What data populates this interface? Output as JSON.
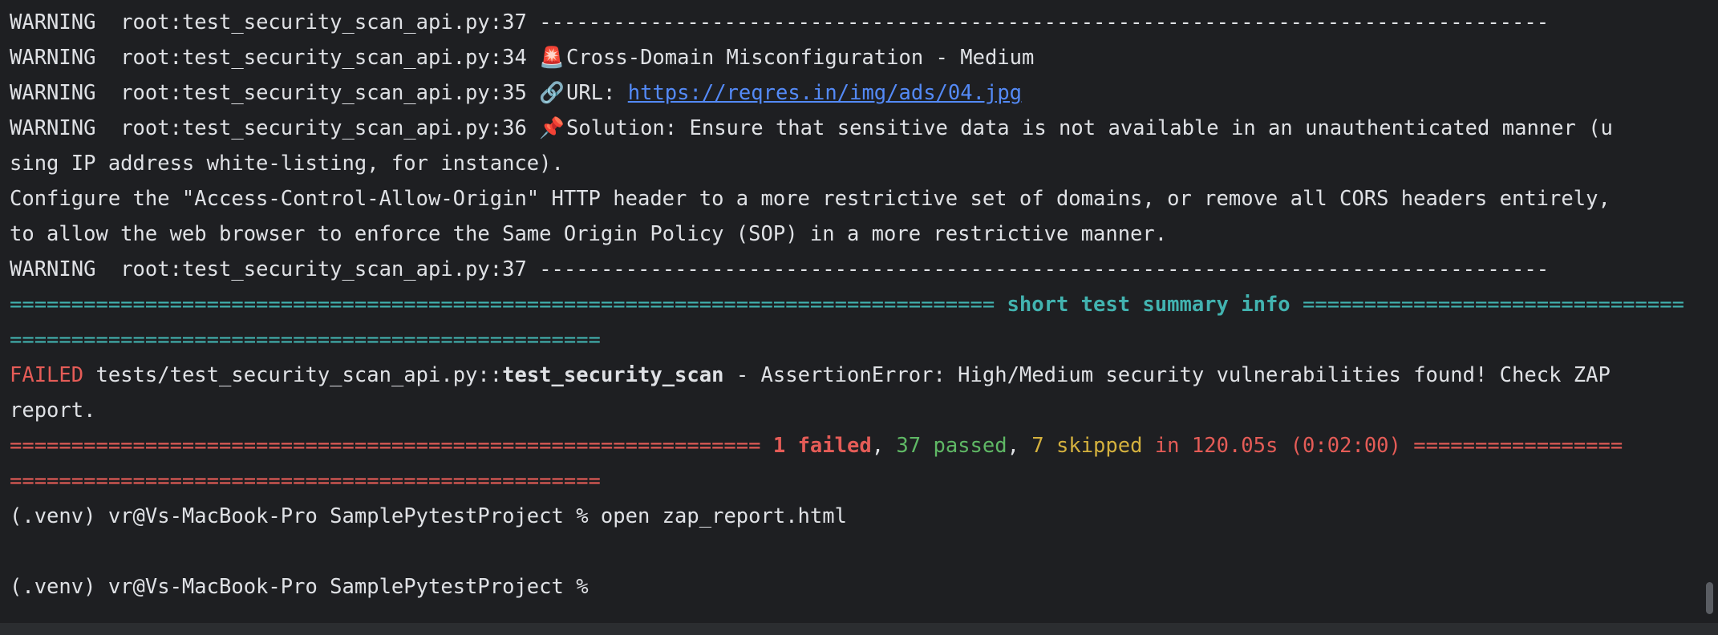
{
  "colors": {
    "background": "#1e1f22",
    "text": "#dfe1e5",
    "link": "#548af7",
    "summary_cyan": "#42b3b0",
    "failed_red": "#e55c57",
    "passed_green": "#5fb865",
    "skipped_yellow": "#d4b13e"
  },
  "lines": {
    "l1": {
      "level": "WARNING ",
      "src": "root:test_security_scan_api.py:37",
      "text": "----------------------------------------------------------------------------------"
    },
    "l2": {
      "level": "WARNING ",
      "src": "root:test_security_scan_api.py:34",
      "icon": "🚨",
      "icon_name": "siren-icon",
      "text": "Cross-Domain Misconfiguration - Medium"
    },
    "l3": {
      "level": "WARNING ",
      "src": "root:test_security_scan_api.py:35",
      "icon": "🔗",
      "icon_name": "link-icon",
      "label": "URL:",
      "url": "https://reqres.in/img/ads/04.jpg"
    },
    "l4": {
      "level": "WARNING ",
      "src": "root:test_security_scan_api.py:36",
      "icon": "📌",
      "icon_name": "pushpin-icon",
      "text": "Solution: Ensure that sensitive data is not available in an unauthenticated manner (u"
    },
    "l5": "sing IP address white-listing, for instance).",
    "l6": "Configure the \"Access-Control-Allow-Origin\" HTTP header to a more restrictive set of domains, or remove all CORS headers entirely,",
    "l7": "to allow the web browser to enforce the Same Origin Policy (SOP) in a more restrictive manner.",
    "l8": {
      "level": "WARNING ",
      "src": "root:test_security_scan_api.py:37",
      "text": "----------------------------------------------------------------------------------"
    },
    "summary_header": {
      "left": "================================================================================",
      "title": "short test summary info",
      "right": "===============================",
      "cont": "================================================"
    },
    "failed_line": {
      "status": "FAILED",
      "path": "tests/test_security_scan_api.py::",
      "test": "test_security_scan",
      "message": "- AssertionError: High/Medium security vulnerabilities found! Check ZAP",
      "cont": "report."
    },
    "result_line": {
      "left": "=============================================================",
      "failed": "1 failed",
      "sep1": ",",
      "passed": "37 passed",
      "sep2": ",",
      "skipped": "7 skipped",
      "duration": "in 120.05s (0:02:00)",
      "right": "=================",
      "cont": "================================================"
    },
    "prompt1": {
      "prompt": "(.venv) vr@Vs-MacBook-Pro SamplePytestProject %",
      "command": "open zap_report.html"
    },
    "prompt2": {
      "prompt": "(.venv) vr@Vs-MacBook-Pro SamplePytestProject %",
      "command": ""
    }
  }
}
